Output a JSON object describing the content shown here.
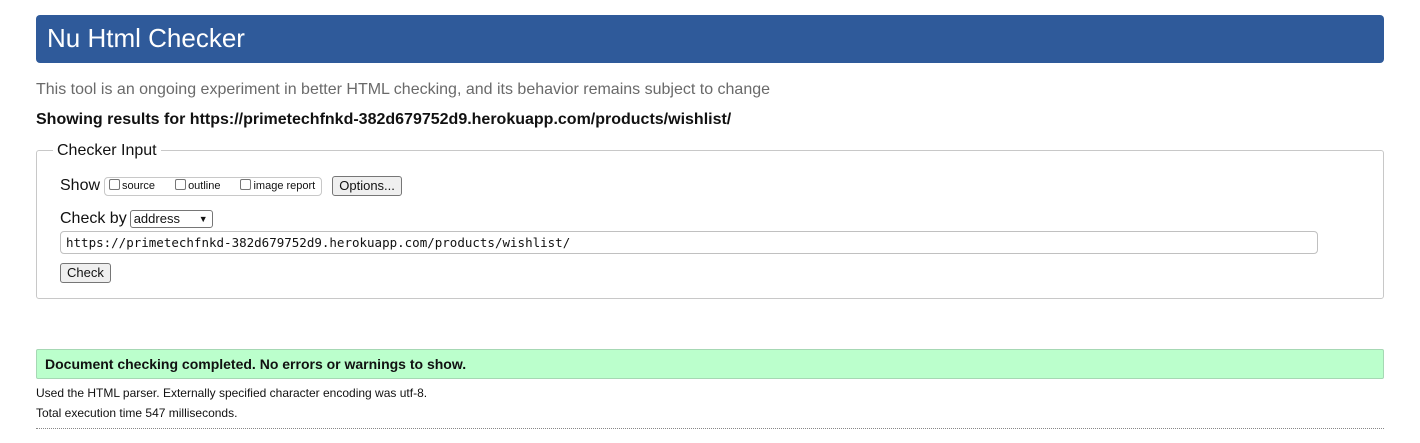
{
  "header": {
    "title": "Nu Html Checker",
    "background_color": "#2f5a9a"
  },
  "tagline": "This tool is an ongoing experiment in better HTML checking, and its behavior remains subject to change",
  "results_for": "Showing results for https://primetechfnkd-382d679752d9.herokuapp.com/products/wishlist/",
  "checker_input": {
    "legend": "Checker Input",
    "show_label": "Show",
    "show_options": [
      {
        "label": "source",
        "checked": false
      },
      {
        "label": "outline",
        "checked": false
      },
      {
        "label": "image report",
        "checked": false
      }
    ],
    "options_button": "Options...",
    "check_by_label": "Check by",
    "check_by_selected": "address",
    "url_value": "https://primetechfnkd-382d679752d9.herokuapp.com/products/wishlist/",
    "check_button": "Check"
  },
  "result": {
    "message": "Document checking completed. No errors or warnings to show.",
    "background_color": "#bbffcc",
    "parser_info": "Used the HTML parser. Externally specified character encoding was utf-8.",
    "execution_time": "Total execution time 547 milliseconds."
  }
}
